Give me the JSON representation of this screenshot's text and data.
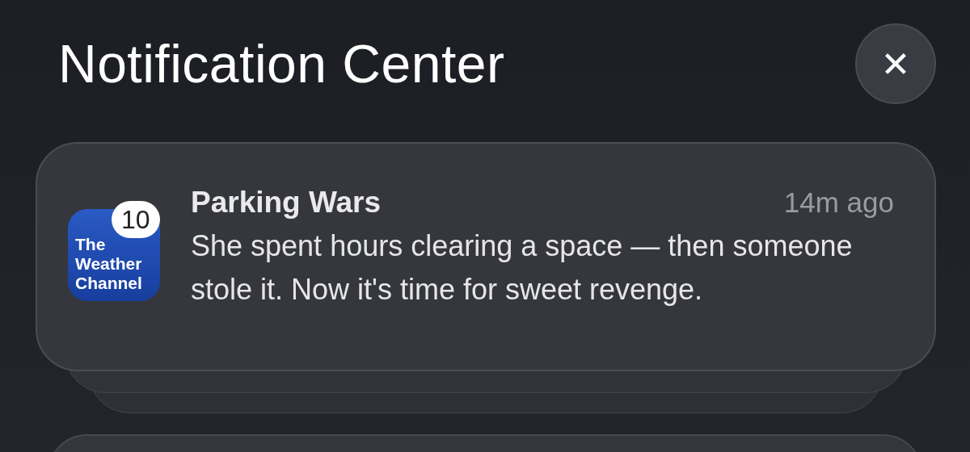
{
  "header": {
    "title": "Notification Center",
    "close_label": "✕"
  },
  "notifications": [
    {
      "app_icon_text": [
        "The",
        "Weather",
        "Channel"
      ],
      "badge": "10",
      "title": "Parking Wars",
      "time": "14m ago",
      "body": "She spent hours clearing a space — then someone stole it. Now it's time for sweet revenge."
    }
  ]
}
